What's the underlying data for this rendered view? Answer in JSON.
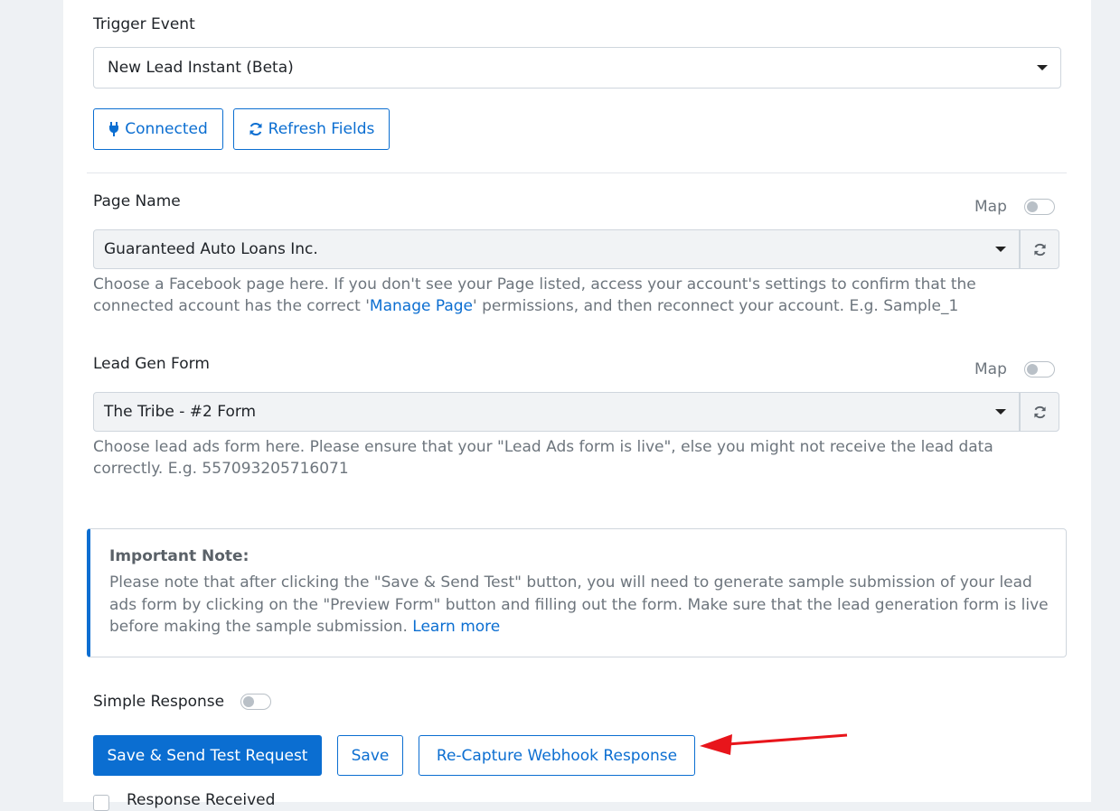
{
  "trigger": {
    "label": "Trigger Event",
    "selected": "New Lead Instant (Beta)",
    "connected_label": "Connected",
    "refresh_fields_label": "Refresh Fields"
  },
  "page_name": {
    "label": "Page Name",
    "map_label": "Map",
    "selected": "Guaranteed Auto Loans Inc.",
    "help_before": "Choose a Facebook page here. If you don't see your Page listed, access your account's settings to confirm that the connected account has the correct '",
    "help_link": "Manage Page",
    "help_after": "' permissions, and then reconnect your account. E.g. Sample_1"
  },
  "lead_form": {
    "label": "Lead Gen Form",
    "map_label": "Map",
    "selected": "The Tribe - #2 Form",
    "help": "Choose lead ads form here. Please ensure that your \"Lead Ads form is live\", else you might not receive the lead data correctly. E.g. 557093205716071"
  },
  "note": {
    "title": "Important Note:",
    "body": "Please note that after clicking the \"Save & Send Test\" button, you will need to generate sample submission of your lead ads form by clicking on the \"Preview Form\" button and filling out the form. Make sure that the lead generation form is live before making the sample submission. ",
    "link": "Learn more"
  },
  "simple_response": {
    "label": "Simple Response"
  },
  "actions": {
    "save_send_label": "Save & Send Test Request",
    "save_label": "Save",
    "recapture_label": "Re-Capture Webhook Response"
  },
  "response_received": {
    "label": "Response Received"
  },
  "colors": {
    "accent": "#0b6ed1",
    "arrow": "#e8151b"
  },
  "icons": {
    "connected": "plug-icon",
    "refresh": "refresh-icon"
  }
}
